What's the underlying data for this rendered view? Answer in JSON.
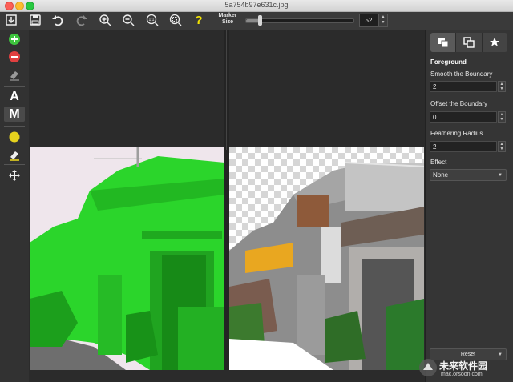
{
  "window": {
    "title": "5a754b97e631c.jpg"
  },
  "toolbar": {
    "icons": [
      "export-icon",
      "save-icon",
      "undo-icon",
      "redo-icon",
      "zoom-in-icon",
      "zoom-out-icon",
      "zoom-actual-icon",
      "zoom-fit-icon",
      "help-icon"
    ],
    "help_glyph": "?",
    "zoom_actual_label": "1:1",
    "marker_label_line1": "Marker",
    "marker_label_line2": "Size",
    "marker_size_value": "52",
    "marker_size_fraction": 0.13
  },
  "tools": {
    "auto_label": "A",
    "manual_label": "M"
  },
  "panel": {
    "section_title": "Foreground",
    "smooth_label": "Smooth the Boundary",
    "smooth_value": "2",
    "offset_label": "Offset the Boundary",
    "offset_value": "0",
    "feather_label": "Feathering Radius",
    "feather_value": "2",
    "effect_label": "Effect",
    "effect_value": "None",
    "reset_label": "Reset"
  },
  "watermark": {
    "name": "未来软件园",
    "url": "mac.orsoon.com"
  },
  "colors": {
    "marker_green": "#2bd52b",
    "keep_yellow": "#e6d21e",
    "accent_green": "#3ec43e",
    "accent_red": "#e04040"
  }
}
